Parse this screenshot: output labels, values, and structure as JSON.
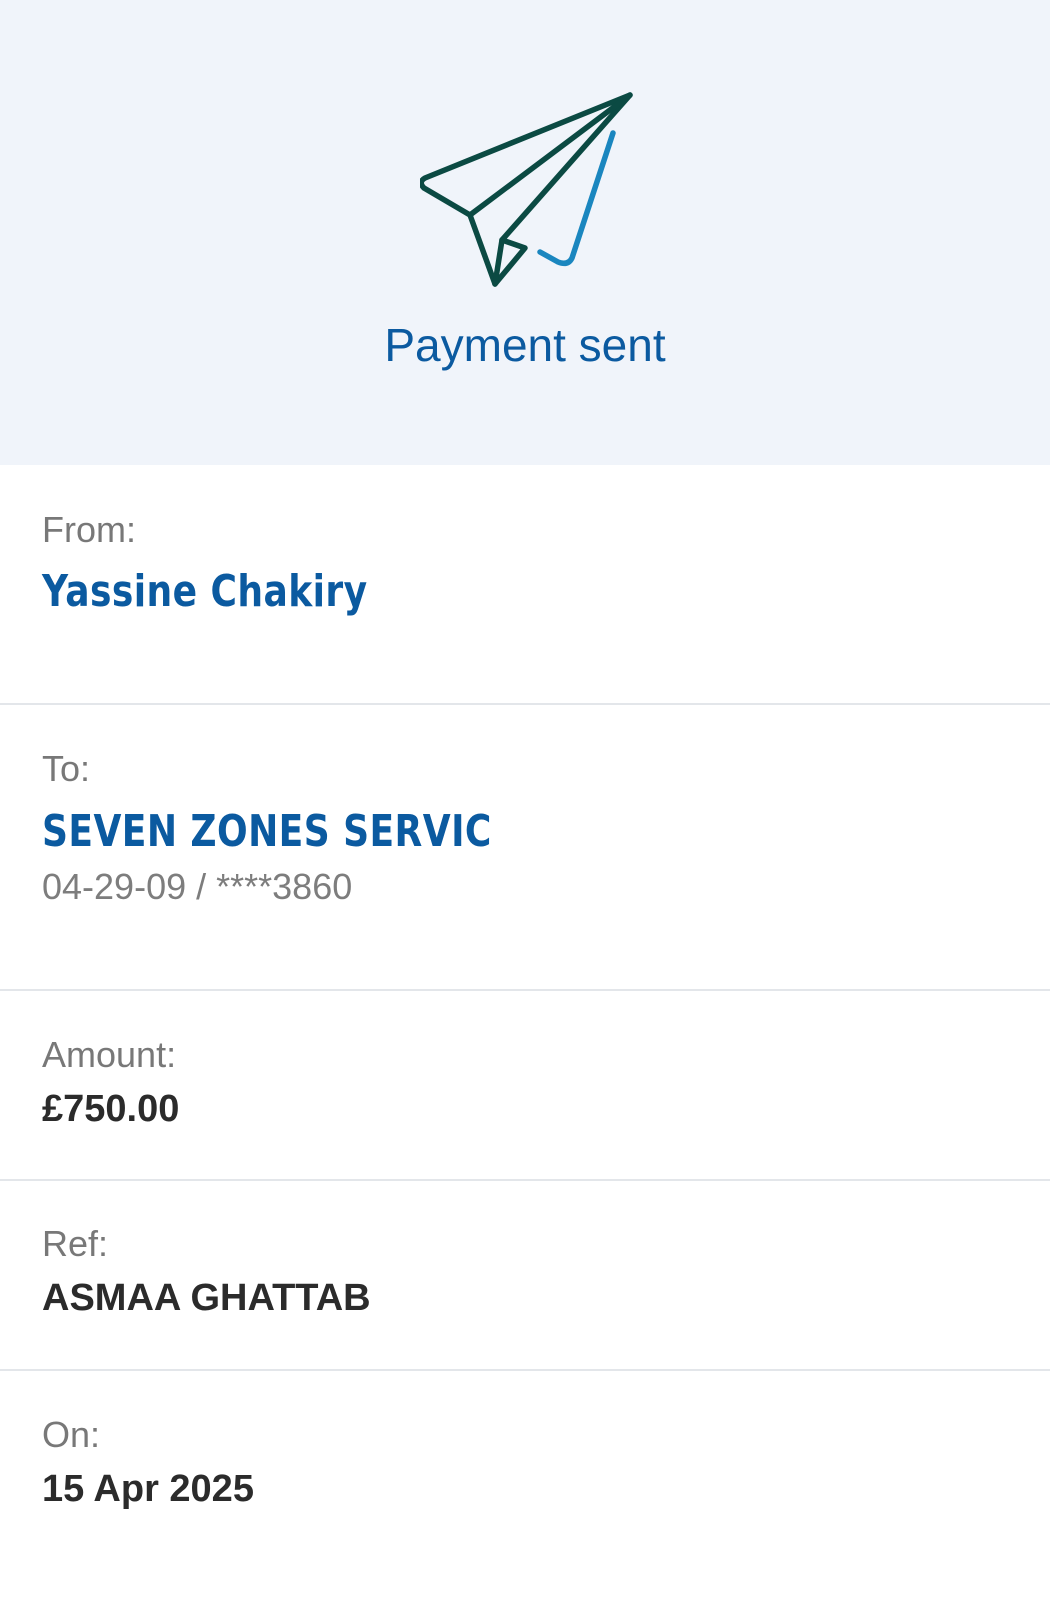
{
  "header": {
    "icon": "paper-plane-icon",
    "title": "Payment sent",
    "colors": {
      "background": "#f0f4fa",
      "title": "#0b5aa0",
      "plane_stroke": "#0b4a43",
      "check_stroke": "#1a86bf"
    }
  },
  "details": {
    "from": {
      "label": "From:",
      "name": "Yassine Chakiry"
    },
    "to": {
      "label": "To:",
      "name": "SEVEN ZONES SERVIC",
      "account": "04-29-09 / ****3860"
    },
    "amount": {
      "label": "Amount:",
      "value": "£750.00"
    },
    "ref": {
      "label": "Ref:",
      "value": "ASMAA GHATTAB"
    },
    "on": {
      "label": "On:",
      "value": "15 Apr 2025"
    }
  },
  "colors": {
    "label": "#787878",
    "party_name": "#0b5aa0",
    "value": "#2b2b2b",
    "divider": "#e3e6ea"
  }
}
